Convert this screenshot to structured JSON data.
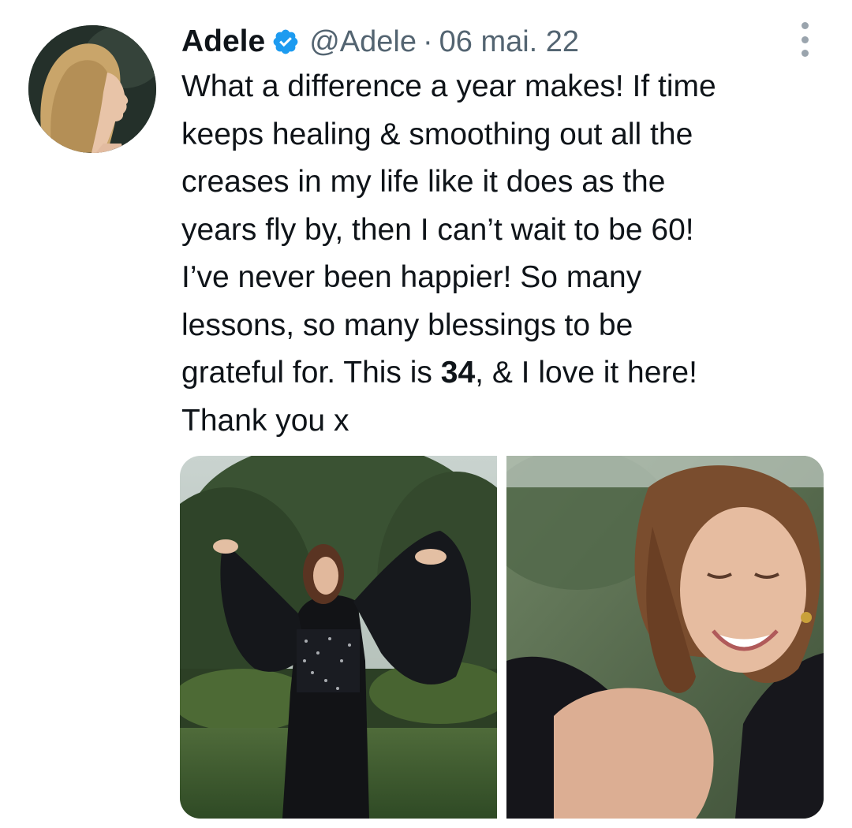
{
  "author": {
    "display_name": "Adele",
    "handle": "@Adele",
    "separator": "·",
    "date": "06 mai. 22",
    "verified": true,
    "avatar_icon": "profile-avatar"
  },
  "menu_icon": "more-vertical-icon",
  "tweet": {
    "lines": {
      "l1": "What a difference a year makes! If time",
      "l2": "keeps healing & smoothing out all the",
      "l3": "creases in my life like it does as the",
      "l4": "years fly by, then I can’t wait to be 60!",
      "l5": "I’ve never been happier! So many",
      "l6": "lessons, so many blessings to be",
      "l7_pre": "grateful for. This is ",
      "l7_bold": "34",
      "l7_post": ", & I love it here!",
      "l8": "Thank you x"
    }
  },
  "colors": {
    "verified_blue": "#1d9bf0",
    "secondary_text": "#536471",
    "primary_text": "#0f1419"
  }
}
